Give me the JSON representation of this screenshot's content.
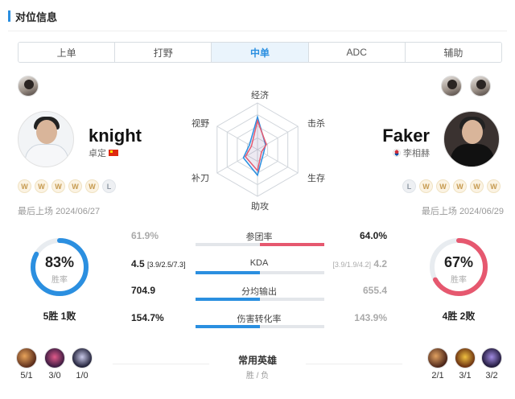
{
  "header": {
    "title": "对位信息"
  },
  "tabs": [
    {
      "label": "上单",
      "active": false
    },
    {
      "label": "打野",
      "active": false
    },
    {
      "label": "中单",
      "active": true
    },
    {
      "label": "ADC",
      "active": false
    },
    {
      "label": "辅助",
      "active": false
    }
  ],
  "left_player": {
    "name": "knight",
    "real_name": "卓定",
    "flag_icon": "china-flag-icon",
    "recent": [
      "W",
      "W",
      "W",
      "W",
      "W",
      "L"
    ],
    "last_played_label": "最后上场",
    "last_played_date": "2024/06/27",
    "win_rate_pct": "83%",
    "win_rate_value": 0.83,
    "win_rate_label": "胜率",
    "record": "5胜 1败",
    "color": "#2b8fe0",
    "heroes": [
      {
        "record": "5/1",
        "icon": "hero-portrait-icon"
      },
      {
        "record": "3/0",
        "icon": "hero-portrait-icon"
      },
      {
        "record": "1/0",
        "icon": "hero-portrait-icon"
      }
    ]
  },
  "right_player": {
    "name": "Faker",
    "real_name": "李相赫",
    "flag_icon": "korea-flag-icon",
    "recent": [
      "L",
      "W",
      "W",
      "W",
      "W",
      "W"
    ],
    "last_played_label": "最后上场",
    "last_played_date": "2024/06/29",
    "win_rate_pct": "67%",
    "win_rate_value": 0.67,
    "win_rate_label": "胜率",
    "record": "4胜 2败",
    "color": "#e6586f",
    "heroes": [
      {
        "record": "2/1",
        "icon": "hero-portrait-icon"
      },
      {
        "record": "3/1",
        "icon": "hero-portrait-icon"
      },
      {
        "record": "3/2",
        "icon": "hero-portrait-icon"
      }
    ]
  },
  "radar": {
    "axes": [
      "经济",
      "击杀",
      "生存",
      "助攻",
      "补刀",
      "视野"
    ],
    "left_values": [
      0.7,
      0.2,
      0.15,
      0.55,
      0.35,
      0.2
    ],
    "right_values": [
      0.62,
      0.22,
      0.1,
      0.45,
      0.3,
      0.15
    ],
    "left_color": "#2b8fe0",
    "right_color": "#e6586f"
  },
  "stats": [
    {
      "name": "参团率",
      "left": "61.9%",
      "left_detail": "",
      "right": "64.0%",
      "right_detail": "",
      "left_dim": true,
      "right_dim": false,
      "left_ratio": 0.0,
      "right_ratio": 1.0
    },
    {
      "name": "KDA",
      "left": "4.5",
      "left_detail": "[3.9/2.5/7.3]",
      "right": "4.2",
      "right_detail": "[3.9/1.9/4.2]",
      "left_dim": false,
      "right_dim": true,
      "left_ratio": 1.0,
      "right_ratio": 0.0
    },
    {
      "name": "分均输出",
      "left": "704.9",
      "left_detail": "",
      "right": "655.4",
      "right_detail": "",
      "left_dim": false,
      "right_dim": true,
      "left_ratio": 1.0,
      "right_ratio": 0.0
    },
    {
      "name": "伤害转化率",
      "left": "154.7%",
      "left_detail": "",
      "right": "143.9%",
      "right_detail": "",
      "left_dim": false,
      "right_dim": true,
      "left_ratio": 1.0,
      "right_ratio": 0.0
    }
  ],
  "common_heroes": {
    "title": "常用英雄",
    "subtitle": "胜 / 负"
  }
}
